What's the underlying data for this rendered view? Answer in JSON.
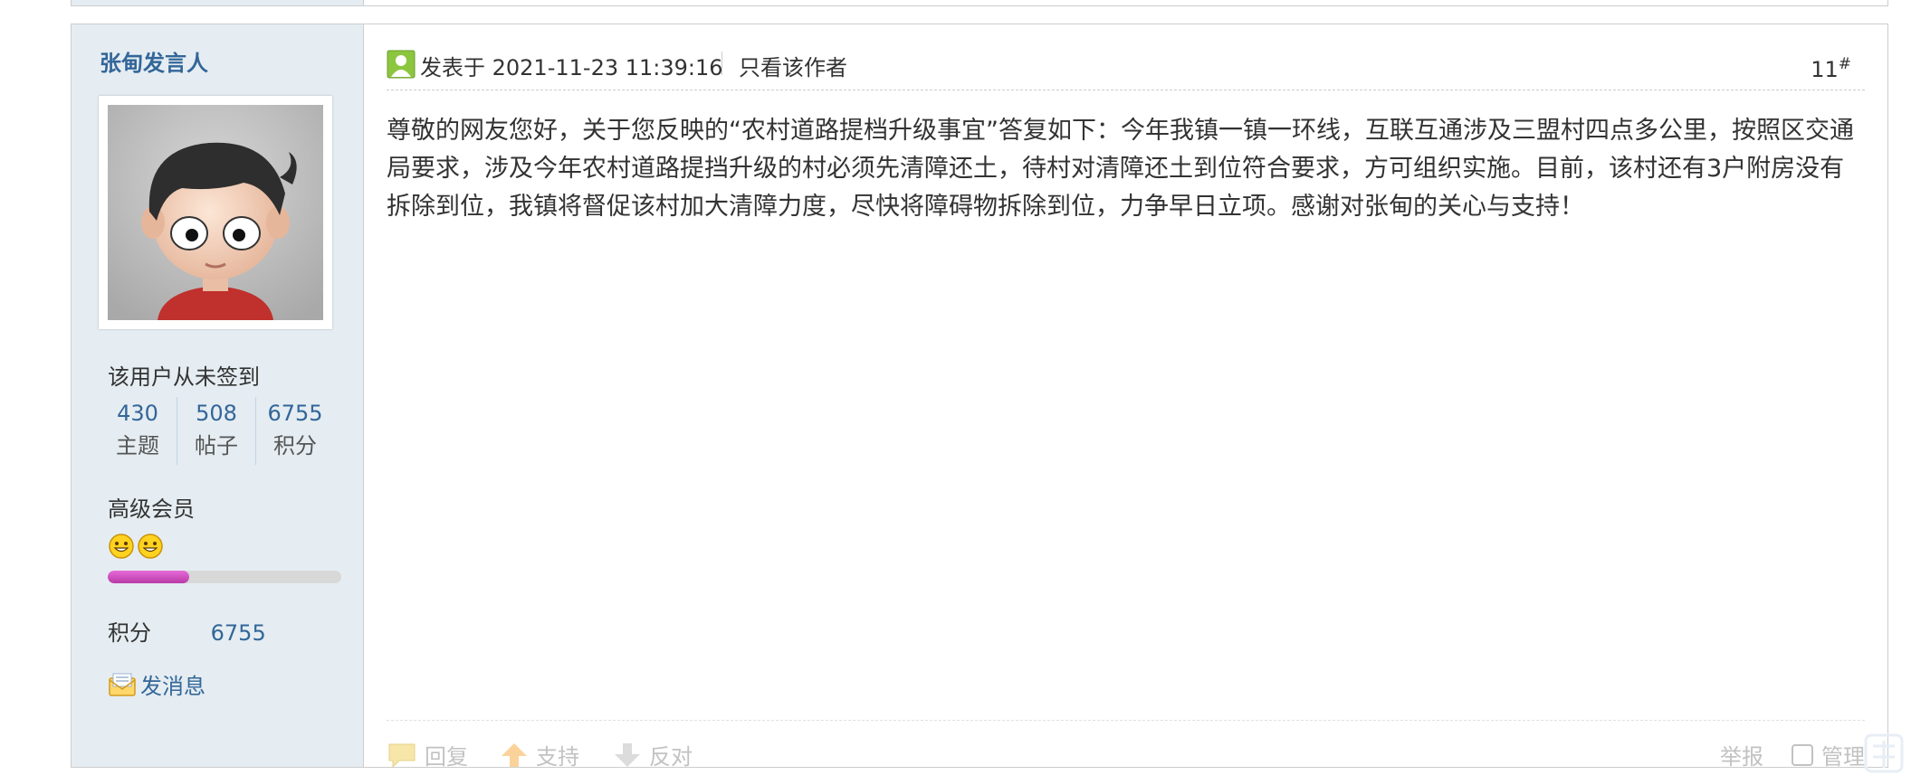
{
  "author": {
    "name": "张甸发言人",
    "sign_status": "该用户从未签到",
    "stats": [
      {
        "num": "430",
        "label": "主题"
      },
      {
        "num": "508",
        "label": "帖子"
      },
      {
        "num": "6755",
        "label": "积分"
      }
    ],
    "level": "高级会员",
    "level_progress": 0.35,
    "credit_label": "积分",
    "credit_value": "6755",
    "send_message": "发消息"
  },
  "post": {
    "posted_label": "发表于 2021-11-23 11:39:16",
    "only_author": "只看该作者",
    "floor": "11",
    "floor_mark": "#",
    "content": "尊敬的网友您好，关于您反映的“农村道路提档升级事宜”答复如下：今年我镇一镇一环线，互联互通涉及三盟村四点多公里，按照区交通局要求，涉及今年农村道路提挡升级的村必须先清障还土，待村对清障还土到位符合要求，方可组织实施。目前，该村还有3户附房没有拆除到位，我镇将督促该村加大清障力度，尽快将障碍物拆除到位，力争早日立项。感谢对张甸的关心与支持！"
  },
  "actions": {
    "reply": "回复",
    "support": "支持",
    "oppose": "反对",
    "report": "举报",
    "manage": "管理"
  },
  "colors": {
    "sidebar_bg": "#e5edf2",
    "link": "#336699",
    "level_bar": "#c94bbb",
    "muted": "#c2c2c2"
  }
}
